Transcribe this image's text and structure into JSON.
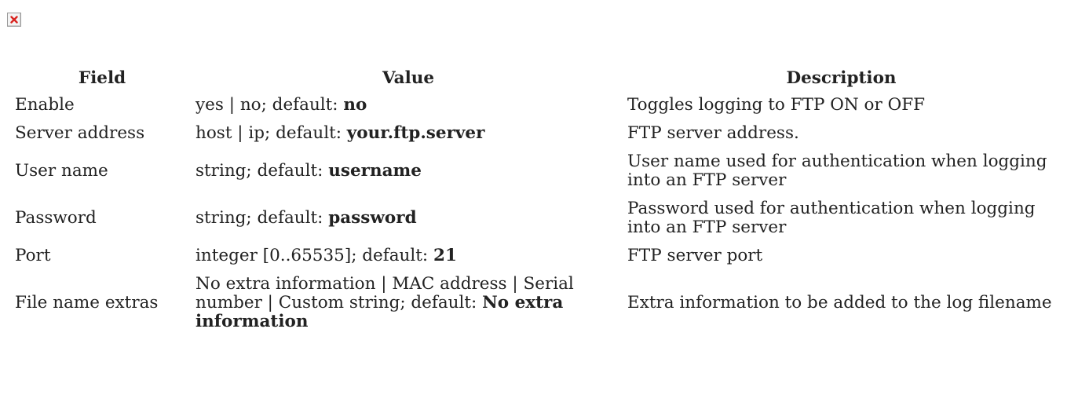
{
  "header": {
    "broken_image_icon": "broken-image-icon"
  },
  "table": {
    "columns": [
      "Field",
      "Value",
      "Description"
    ],
    "rows": [
      {
        "field": "Enable",
        "value_prefix": "yes | no; default: ",
        "value_default": "no",
        "description": "Toggles logging to FTP ON or OFF"
      },
      {
        "field": "Server address",
        "value_prefix": "host | ip; default: ",
        "value_default": "your.ftp.server",
        "description": "FTP server address."
      },
      {
        "field": "User name",
        "value_prefix": "string; default: ",
        "value_default": "username",
        "description": "User name used for authentication when logging into an FTP server"
      },
      {
        "field": "Password",
        "value_prefix": "string; default: ",
        "value_default": "password",
        "description": "Password used for authentication when logging into an FTP server"
      },
      {
        "field": "Port",
        "value_prefix": "integer [0..65535]; default: ",
        "value_default": "21",
        "description": "FTP server port"
      },
      {
        "field": "File name extras",
        "value_prefix": "No extra information | MAC address | Serial number | Custom string; default: ",
        "value_default": "No extra information",
        "description": "Extra information to be added to the log filename"
      }
    ]
  }
}
